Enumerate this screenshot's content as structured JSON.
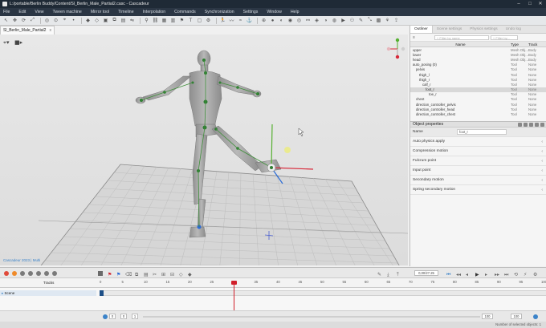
{
  "window": {
    "title": "L:/portable/Berlin Buddy/Content/Sl_Berlin_Male_Partial2.casc - Cascadeur",
    "controls": [
      "–",
      "□",
      "✕"
    ]
  },
  "menu": [
    "File",
    "Edit",
    "View",
    "Tween machine",
    "Mirror tool",
    "Timeline",
    "Interpolation",
    "Commands",
    "Synchronization",
    "Settings",
    "Window",
    "Help"
  ],
  "document_tab": {
    "label": "Sl_Berlin_Male_Partial2",
    "close": "x"
  },
  "viewport": {
    "status_text": "Cascadeur 2023 | Multi",
    "accent": "#3b83c9",
    "background": "#e4e4e4"
  },
  "right_panel": {
    "tabs": [
      "Outliner",
      "Scene settings",
      "Physics settings",
      "Undo log"
    ],
    "filter_placeholder": "+ Filter by name",
    "filter2_placeholder": "+ Filter by...",
    "columns": [
      "Name",
      "Type",
      "Track"
    ],
    "rows": [
      {
        "name": "upper",
        "type": "Mesh Obj...",
        "track": "Body",
        "indent": 0,
        "sel": false
      },
      {
        "name": "lower",
        "type": "Mesh Obj...",
        "track": "Body",
        "indent": 0,
        "sel": false
      },
      {
        "name": "head",
        "type": "Mesh Obj...",
        "track": "Body",
        "indent": 0,
        "sel": false
      },
      {
        "name": "auto_posing (0)",
        "type": "Tool",
        "track": "None",
        "indent": 0,
        "sel": false
      },
      {
        "name": "pelvis",
        "type": "Tool",
        "track": "None",
        "indent": 1,
        "sel": false
      },
      {
        "name": "thigh_l",
        "type": "Tool",
        "track": "None",
        "indent": 2,
        "sel": false
      },
      {
        "name": "thigh_r",
        "type": "Tool",
        "track": "None",
        "indent": 2,
        "sel": false
      },
      {
        "name": "calf_r",
        "type": "Tool",
        "track": "None",
        "indent": 3,
        "sel": false
      },
      {
        "name": "foot_r",
        "type": "Tool",
        "track": "None",
        "indent": 4,
        "sel": true
      },
      {
        "name": "toe_r",
        "type": "Tool",
        "track": "None",
        "indent": 5,
        "sel": false
      },
      {
        "name": "chest",
        "type": "Tool",
        "track": "None",
        "indent": 1,
        "sel": false
      },
      {
        "name": "direction_controller_pelvis",
        "type": "Tool",
        "track": "None",
        "indent": 1,
        "sel": false
      },
      {
        "name": "direction_controller_head",
        "type": "Tool",
        "track": "None",
        "indent": 1,
        "sel": false
      },
      {
        "name": "direction_controller_chest",
        "type": "Tool",
        "track": "None",
        "indent": 1,
        "sel": false
      }
    ],
    "object_properties": {
      "title": "Object properties",
      "name_label": "Name",
      "name_value": "foot_r",
      "sections": [
        "Auto physics apply",
        "Compression motion",
        "Fulcrum point",
        "Input point",
        "Secondary motion",
        "Spring secondary motion"
      ]
    }
  },
  "timeline": {
    "tracks_label": "Tracks",
    "track_name": "Scene",
    "frame_field": "0,00/27.25",
    "ticks": [
      "0",
      "5",
      "10",
      "15",
      "20",
      "25",
      "30",
      "35",
      "40",
      "45",
      "50",
      "55",
      "60",
      "65",
      "70",
      "75",
      "80",
      "85",
      "90",
      "95",
      "100"
    ],
    "current_frame": 30,
    "max_frame": 100,
    "footer_start": "0",
    "footer_end_a": "100",
    "footer_end_b": "100",
    "footer_left_value": "0",
    "footer_mid_value": "1",
    "playhead_color": "#d11f2a"
  },
  "status_bar": {
    "right_text": "Number of selected objects: 1"
  }
}
